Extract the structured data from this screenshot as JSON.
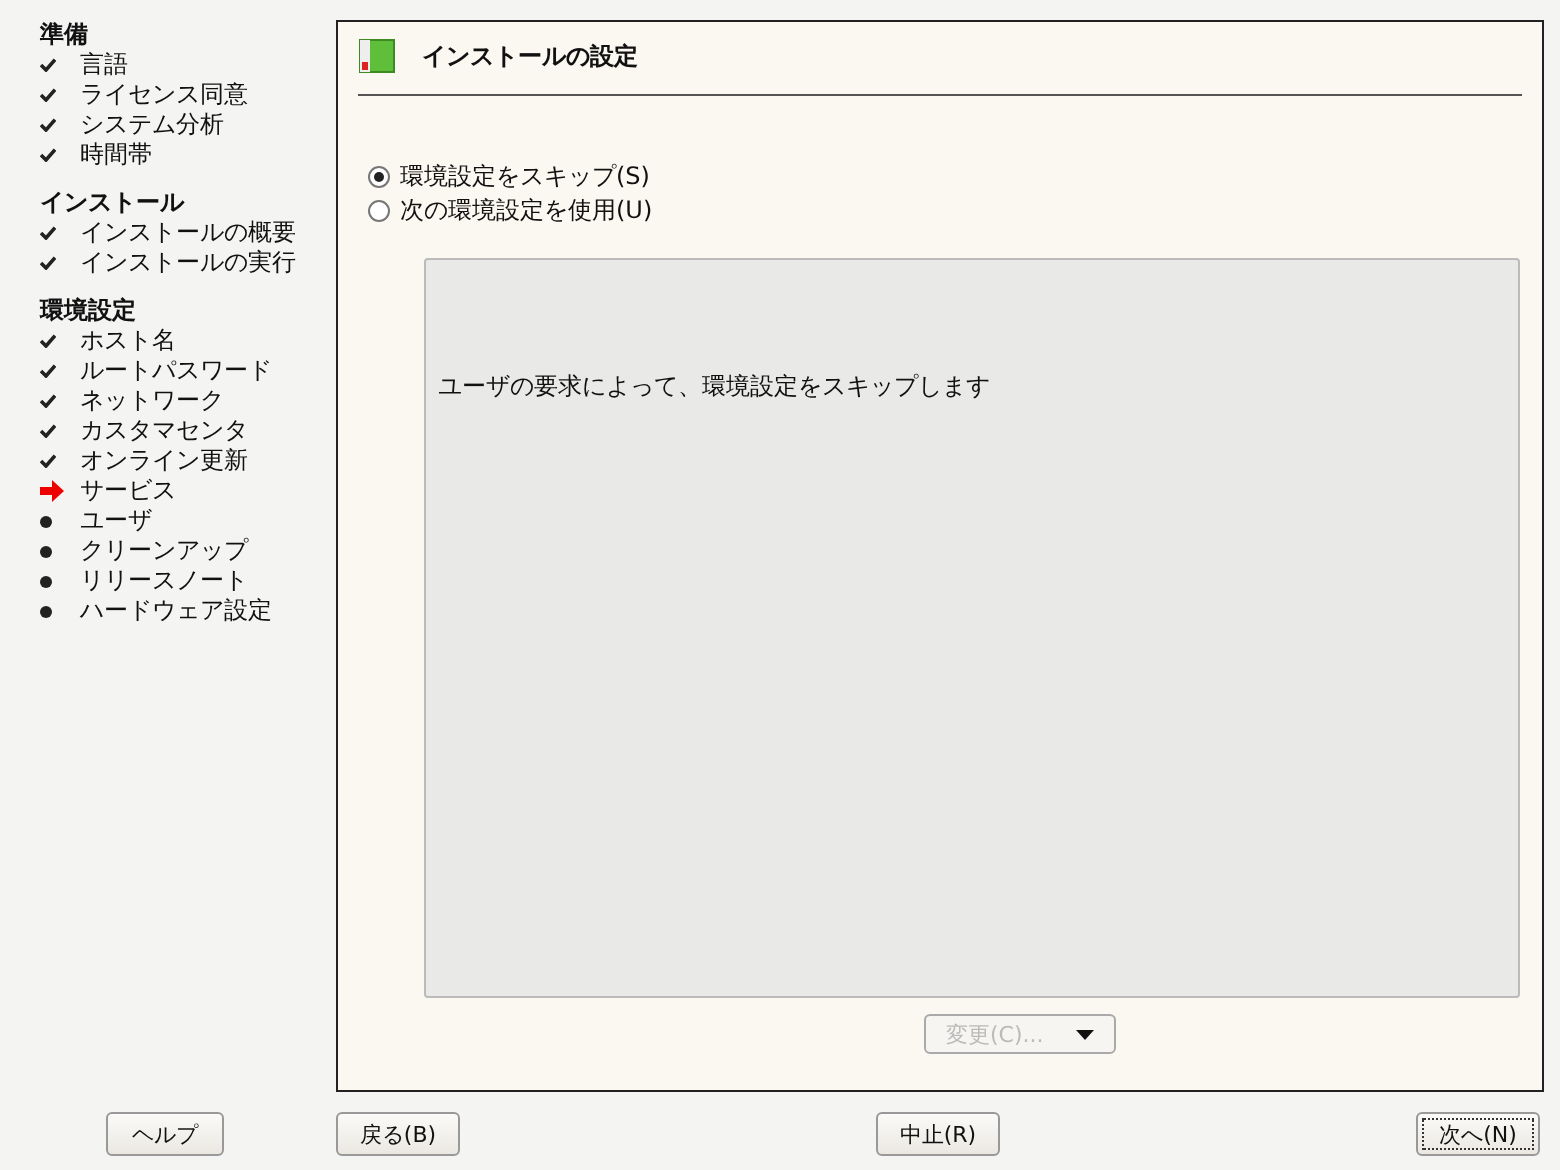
{
  "sidebar": {
    "sections": [
      {
        "title": "準備",
        "items": [
          {
            "label": "言語",
            "kind": "done"
          },
          {
            "label": "ライセンス同意",
            "kind": "done"
          },
          {
            "label": "システム分析",
            "kind": "done"
          },
          {
            "label": "時間帯",
            "kind": "done"
          }
        ]
      },
      {
        "title": "インストール",
        "items": [
          {
            "label": "インストールの概要",
            "kind": "done"
          },
          {
            "label": "インストールの実行",
            "kind": "done"
          }
        ]
      },
      {
        "title": "環境設定",
        "items": [
          {
            "label": "ホスト名",
            "kind": "done"
          },
          {
            "label": "ルートパスワード",
            "kind": "done"
          },
          {
            "label": "ネットワーク",
            "kind": "done"
          },
          {
            "label": "カスタマセンタ",
            "kind": "done"
          },
          {
            "label": "オンライン更新",
            "kind": "done"
          },
          {
            "label": "サービス",
            "kind": "current"
          },
          {
            "label": "ユーザ",
            "kind": "todo"
          },
          {
            "label": "クリーンアップ",
            "kind": "todo"
          },
          {
            "label": "リリースノート",
            "kind": "todo"
          },
          {
            "label": "ハードウェア設定",
            "kind": "todo"
          }
        ]
      }
    ]
  },
  "panel": {
    "title": "インストールの設定",
    "options": [
      {
        "label": "環境設定をスキップ(S)",
        "selected": true
      },
      {
        "label": "次の環境設定を使用(U)",
        "selected": false
      }
    ],
    "message": "ユーザの要求によって、環境設定をスキップします",
    "change_button": {
      "label": "変更(C)...",
      "disabled": true
    }
  },
  "buttons": [
    {
      "label": "ヘルプ",
      "focused": false
    },
    {
      "label": "戻る(B)",
      "focused": false
    },
    {
      "label": "中止(R)",
      "focused": false
    },
    {
      "label": "次へ(N)",
      "focused": true
    }
  ]
}
